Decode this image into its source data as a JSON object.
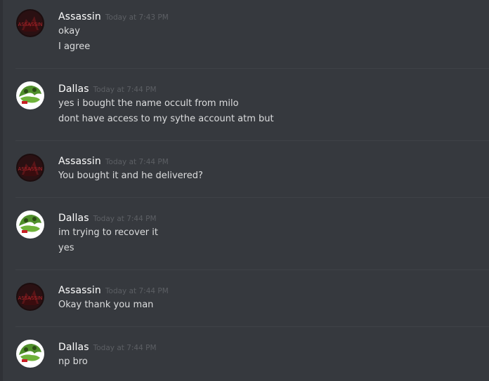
{
  "messages": [
    {
      "author": "Assassin",
      "timestamp": "Today at 7:43 PM",
      "lines": [
        "okay",
        "I agree"
      ]
    },
    {
      "author": "Dallas",
      "timestamp": "Today at 7:44 PM",
      "lines": [
        "yes i bought the name occult from milo",
        "dont have access to my sythe account atm but"
      ]
    },
    {
      "author": "Assassin",
      "timestamp": "Today at 7:44 PM",
      "lines": [
        "You bought it and he delivered?"
      ]
    },
    {
      "author": "Dallas",
      "timestamp": "Today at 7:44 PM",
      "lines": [
        "im trying to recover it",
        "yes"
      ]
    },
    {
      "author": "Assassin",
      "timestamp": "Today at 7:44 PM",
      "lines": [
        "Okay thank you man"
      ]
    },
    {
      "author": "Dallas",
      "timestamp": "Today at 7:44 PM",
      "lines": [
        "np bro"
      ]
    }
  ],
  "avatars": {
    "assassin": {
      "icon": "assassin-avatar-icon",
      "text": "ASSASSIN"
    },
    "dallas": {
      "icon": "frog-avatar-icon"
    }
  },
  "colors": {
    "background": "#36393e",
    "username": "#ffffff",
    "timestamp": "#5c5f64",
    "message": "#dcddde",
    "divider": "#3f4247"
  }
}
